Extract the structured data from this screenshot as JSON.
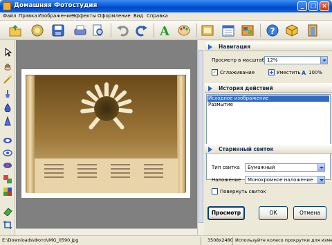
{
  "window": {
    "title": "Домашняя Фотостудия"
  },
  "menu": [
    "Файл",
    "Правка",
    "Изображение",
    "Эффекты",
    "Оформление",
    "Вид",
    "Справка"
  ],
  "navigation": {
    "title": "Навигация",
    "zoom_label": "Просмотр в масштабе",
    "zoom_value": "12%",
    "smoothing_label": "Сглаживание",
    "smoothing_checked": "✓",
    "fit_label": "Уместить",
    "actual_label": "100%"
  },
  "history": {
    "title": "История действий",
    "items": [
      "Исходное изображение",
      "Размытие"
    ]
  },
  "effect": {
    "title": "Старинный свиток",
    "scroll_type_label": "Тип свитка",
    "scroll_type_value": "Бумажный",
    "overlay_label": "Наложение",
    "overlay_value": "Монохромное наложение",
    "flip_label": "Повернуть свиток"
  },
  "buttons": {
    "preview": "Просмотр",
    "ok": "ОК",
    "cancel": "Отмена"
  },
  "status": {
    "path": "E:\\Downloads\\Фото\\IMG_0590.jpg",
    "size": "3508x2480",
    "hint": "Используйте колесо прокрутки для изменен"
  },
  "colors": {
    "accent": "#316ac5",
    "titlebar": "#0a5fd8",
    "section_arrow": "#3060c0"
  }
}
